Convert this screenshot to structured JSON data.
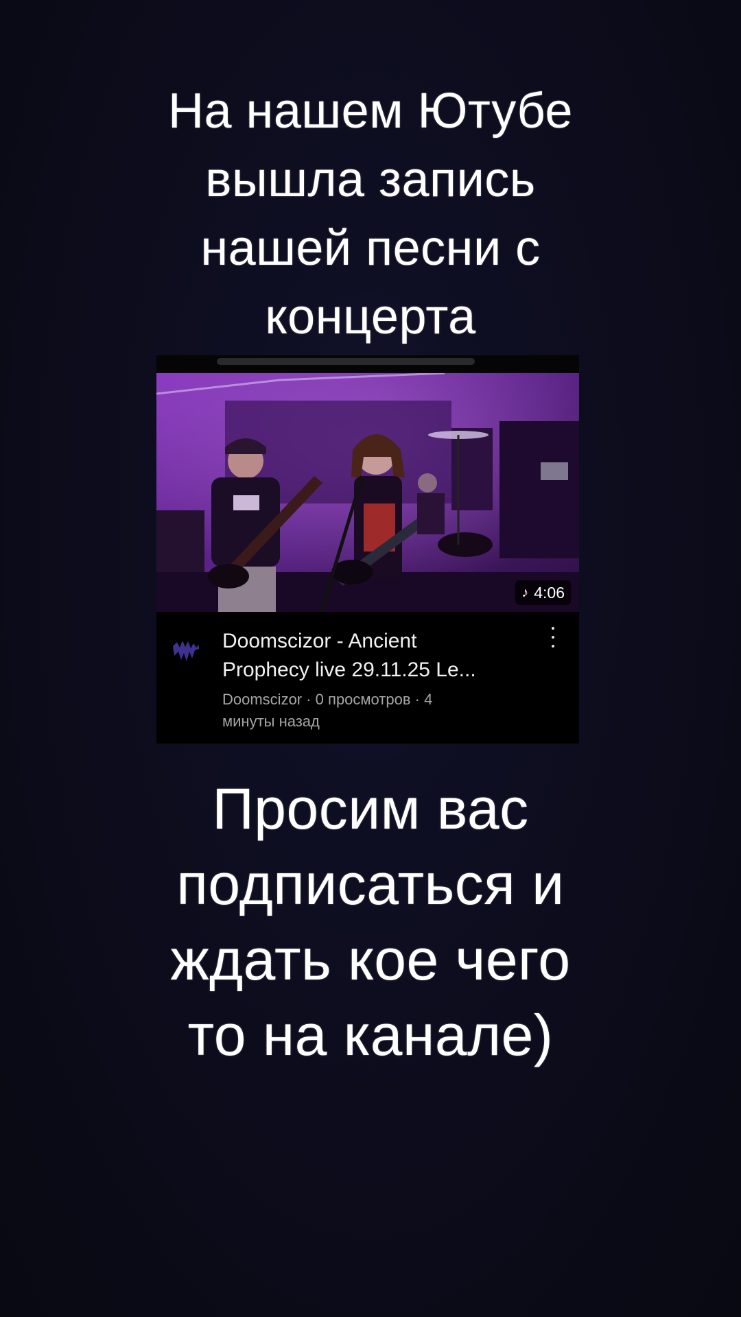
{
  "caption_top": {
    "lines": [
      "На нашем Ютубе",
      "вышла запись",
      "нашей песни с",
      "концерта"
    ]
  },
  "video_card": {
    "duration": "4:06",
    "duration_icon": "music-note-icon",
    "title_lines": [
      "Doomscizor - Ancient",
      "Prophecy live 29.11.25 Le..."
    ],
    "meta_lines": [
      "Doomscizor · 0 просмотров · 4",
      "минуты назад"
    ],
    "menu_icon": "more-vert-icon",
    "avatar_icon": "channel-logo",
    "thumbnail_tint": "#7a2fa8"
  },
  "caption_bottom": {
    "lines": [
      "Просим вас",
      "подписаться и",
      "ждать кое чего",
      "то на канале)"
    ]
  },
  "colors": {
    "background": "#0b0b18",
    "text": "#ffffff",
    "meta_text": "#a6a6a6"
  }
}
